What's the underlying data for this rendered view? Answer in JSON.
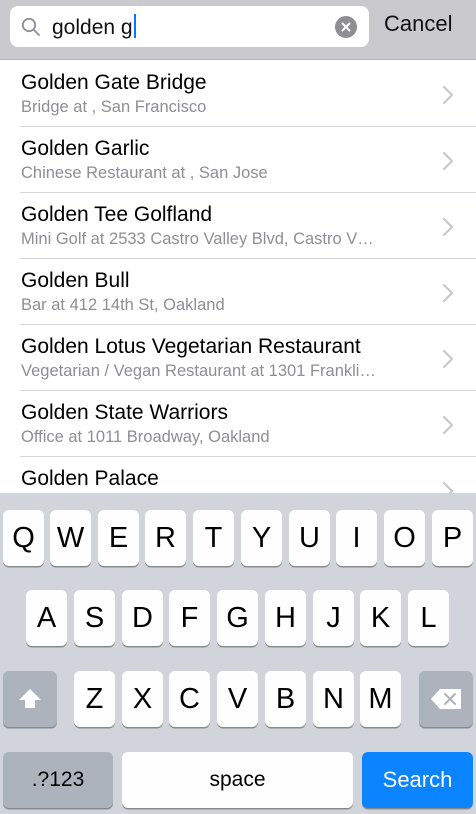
{
  "search": {
    "query": "golden g",
    "cancel_label": "Cancel"
  },
  "results": [
    {
      "title": "Golden Gate Bridge",
      "subtitle": "Bridge at , San Francisco"
    },
    {
      "title": "Golden Garlic",
      "subtitle": "Chinese Restaurant at , San Jose"
    },
    {
      "title": "Golden Tee Golfland",
      "subtitle": "Mini Golf at 2533 Castro Valley Blvd, Castro V…"
    },
    {
      "title": "Golden Bull",
      "subtitle": "Bar at 412 14th St, Oakland"
    },
    {
      "title": "Golden Lotus Vegetarian Restaurant",
      "subtitle": "Vegetarian / Vegan Restaurant at 1301 Frankli…"
    },
    {
      "title": "Golden State Warriors",
      "subtitle": "Office at 1011 Broadway, Oakland"
    },
    {
      "title": "Golden Palace",
      "subtitle": ""
    }
  ],
  "keyboard": {
    "row1": [
      "Q",
      "W",
      "E",
      "R",
      "T",
      "Y",
      "U",
      "I",
      "O",
      "P"
    ],
    "row2": [
      "A",
      "S",
      "D",
      "F",
      "G",
      "H",
      "J",
      "K",
      "L"
    ],
    "row3": [
      "Z",
      "X",
      "C",
      "V",
      "B",
      "N",
      "M"
    ],
    "numbers_label": ".?123",
    "space_label": "space",
    "search_label": "Search"
  },
  "colors": {
    "accent": "#007aff",
    "search_key": "#0a84ff",
    "keyboard_bg": "#d1d5db",
    "header_bg": "#c9c9ce"
  },
  "icons": {
    "search": "magnifier-icon",
    "clear": "clear-x-icon",
    "row": "chevron-right-icon",
    "shift": "shift-arrow-icon",
    "delete": "backspace-icon"
  }
}
